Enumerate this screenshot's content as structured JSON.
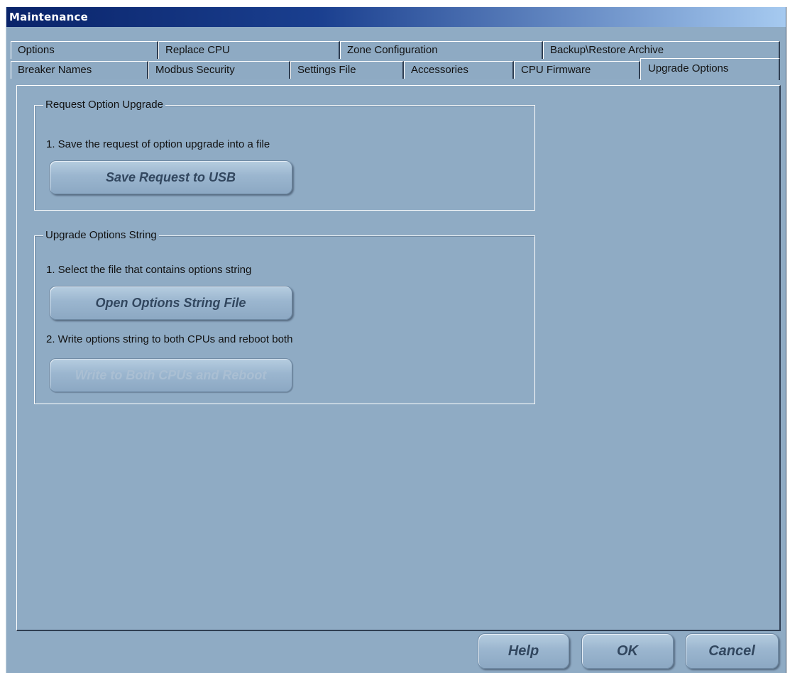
{
  "window": {
    "title": "Maintenance"
  },
  "tabs": {
    "row1": [
      {
        "label": "Options"
      },
      {
        "label": "Replace CPU"
      },
      {
        "label": "Zone Configuration"
      },
      {
        "label": "Backup\\Restore Archive"
      }
    ],
    "row2": [
      {
        "label": "Breaker Names"
      },
      {
        "label": "Modbus Security"
      },
      {
        "label": "Settings File"
      },
      {
        "label": "Accessories"
      },
      {
        "label": "CPU Firmware"
      },
      {
        "label": "Upgrade Options",
        "selected": true
      }
    ]
  },
  "request_group": {
    "title": "Request Option Upgrade",
    "step1": "1. Save the request of option upgrade into a file",
    "save_button": "Save Request to USB"
  },
  "upgrade_group": {
    "title": "Upgrade Options String",
    "step1": "1. Select the file that contains options string",
    "open_button": "Open Options String File",
    "step2": "2. Write options string to both CPUs and reboot both",
    "write_button": "Write to Both CPUs and Reboot",
    "write_button_enabled": false
  },
  "footer": {
    "help_label": "Help",
    "ok_label": "OK",
    "cancel_label": "Cancel"
  },
  "colors": {
    "background": "#8fabc4",
    "titlebar_start": "#0a246a",
    "titlebar_end": "#a6caf0",
    "button_text": "#32475f",
    "disabled_text": "#aabfd3"
  }
}
